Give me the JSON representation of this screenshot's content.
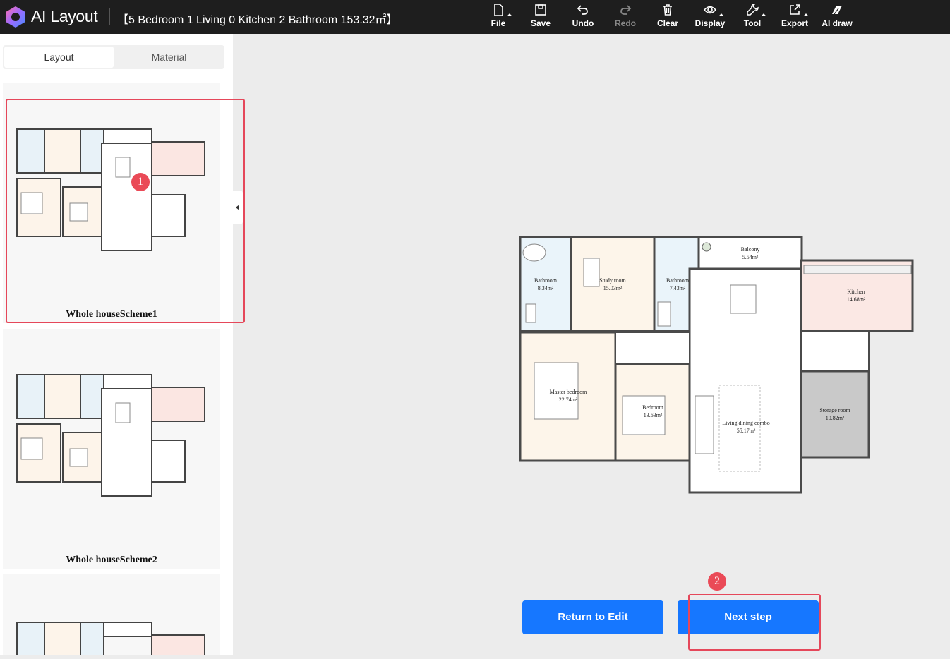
{
  "header": {
    "app_name": "AI Layout",
    "house_title": "【5 Bedroom 1 Living 0 Kitchen 2 Bathroom 153.32㎡】"
  },
  "toolbar": {
    "file": "File",
    "save": "Save",
    "undo": "Undo",
    "redo": "Redo",
    "clear": "Clear",
    "display": "Display",
    "tool": "Tool",
    "export": "Export",
    "ai_draw": "AI draw"
  },
  "sidebar": {
    "tabs": [
      "Layout",
      "Material"
    ],
    "schemes": [
      {
        "label": "Whole houseScheme1"
      },
      {
        "label": "Whole houseScheme2"
      },
      {
        "label": ""
      }
    ]
  },
  "badges": [
    "1",
    "2"
  ],
  "plan": {
    "rooms": [
      {
        "name": "Bathroom",
        "area": "8.34m²"
      },
      {
        "name": "Study room",
        "area": "15.03m²"
      },
      {
        "name": "Bathroom",
        "area": "7.43m²"
      },
      {
        "name": "Balcony",
        "area": "5.54m²"
      },
      {
        "name": "Kitchen",
        "area": "14.68m²"
      },
      {
        "name": "Master bedroom",
        "area": "22.74m²"
      },
      {
        "name": "Bedroom",
        "area": "13.63m²"
      },
      {
        "name": "Living dining combo",
        "area": "55.17m²"
      },
      {
        "name": "Storage room",
        "area": "10.82m²"
      }
    ]
  },
  "buttons": {
    "return_label": "Return to Edit",
    "next_label": "Next step"
  },
  "colors": {
    "accent": "#1677ff",
    "highlight": "#e5475a",
    "topbar": "#1e1e1e"
  }
}
